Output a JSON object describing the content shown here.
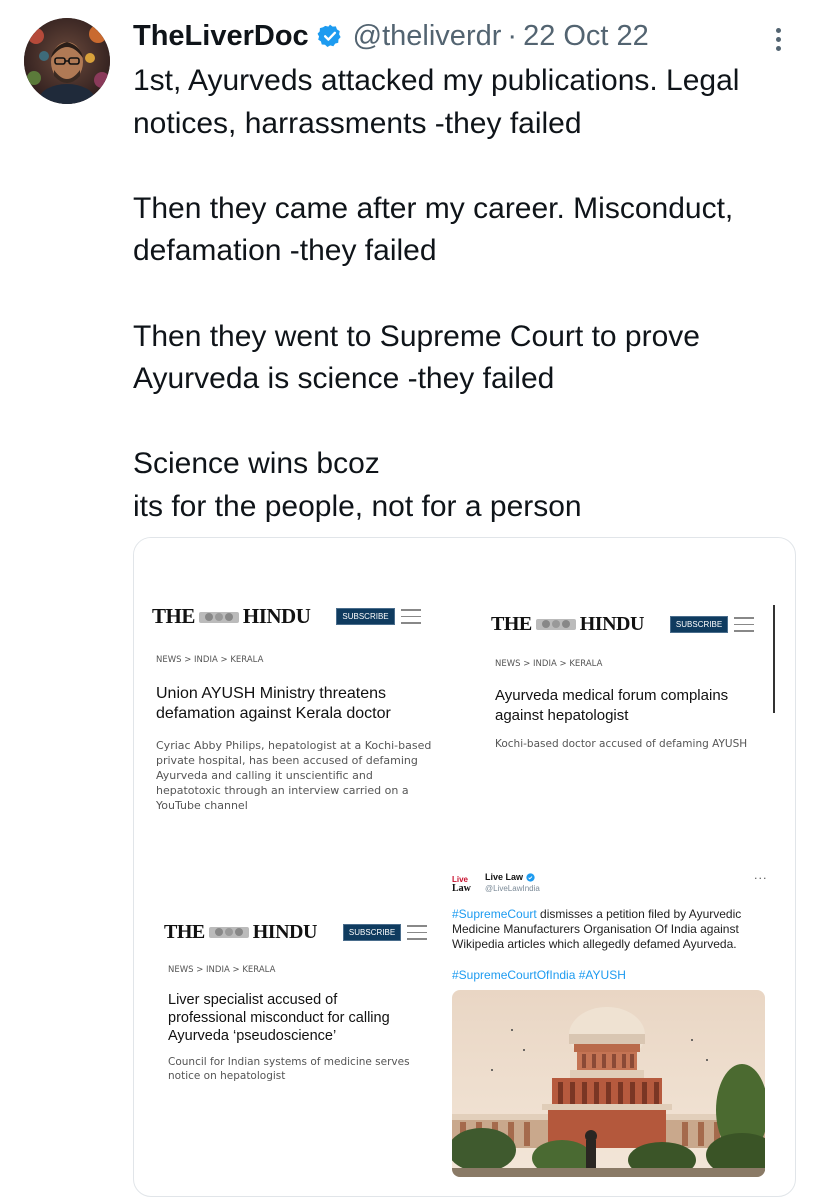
{
  "tweet": {
    "author_name": "TheLiverDoc",
    "handle": "@theliverdr",
    "separator": "·",
    "date": "22 Oct 22",
    "lines": [
      "1st, Ayurveds attacked my publications. Legal",
      "notices, harrassments -they failed",
      "",
      "Then they came after my career. Misconduct,",
      "defamation -they failed",
      "",
      "Then they went to Supreme Court to prove",
      "Ayurveda is science -they failed",
      "",
      "Science wins bcoz",
      "its for the people, not for a person"
    ]
  },
  "media": {
    "card1": {
      "logo_left": "THE",
      "logo_right": "HINDU",
      "subscribe": "SUBSCRIBE",
      "crumbs": "NEWS > INDIA > KERALA",
      "headline_line1": "Union AYUSH Ministry threatens",
      "headline_line2": "defamation against Kerala doctor",
      "summary_lines": [
        "Cyriac Abby Philips, hepatologist at a Kochi-based",
        "private hospital, has been accused of defaming",
        "Ayurveda and calling it unscientific and",
        "hepatotoxic through an interview carried on a",
        "YouTube channel"
      ]
    },
    "card2": {
      "logo_left": "THE",
      "logo_right": "HINDU",
      "subscribe": "SUBSCRIBE",
      "crumbs": "NEWS > INDIA > KERALA",
      "headline_line1": "Ayurveda medical forum complains",
      "headline_line2": "against hepatologist",
      "summary_lines": [
        "Kochi-based doctor accused of defaming AYUSH"
      ]
    },
    "card3": {
      "logo_left": "THE",
      "logo_right": "HINDU",
      "subscribe": "SUBSCRIBE",
      "crumbs": "NEWS > INDIA > KERALA",
      "headline_line1": "Liver specialist accused of",
      "headline_line2": "professional misconduct for calling",
      "headline_line3": "Ayurveda ‘pseudoscience’",
      "summary_lines": [
        "Council for Indian systems of medicine serves",
        "notice on hepatologist"
      ]
    },
    "card4": {
      "name": "Live Law",
      "handle": "@LiveLawIndia",
      "more": "···",
      "tag1": "#SupremeCourt",
      "text_rest": " dismisses a petition filed by Ayurvedic Medicine Manufacturers Organisation Of India against Wikipedia articles which allegedly defamed Ayurveda.",
      "tags": "#SupremeCourtOfIndia #AYUSH"
    }
  },
  "colors": {
    "verified_blue": "#1d9bf0",
    "text": "#0f1419",
    "muted": "#536471",
    "hindu_subscribe": "#0f3b5f"
  },
  "icons": [
    "verified-badge-icon",
    "more-options-icon",
    "hindu-crest-icon",
    "hamburger-menu-icon",
    "livelaw-logo-icon"
  ]
}
